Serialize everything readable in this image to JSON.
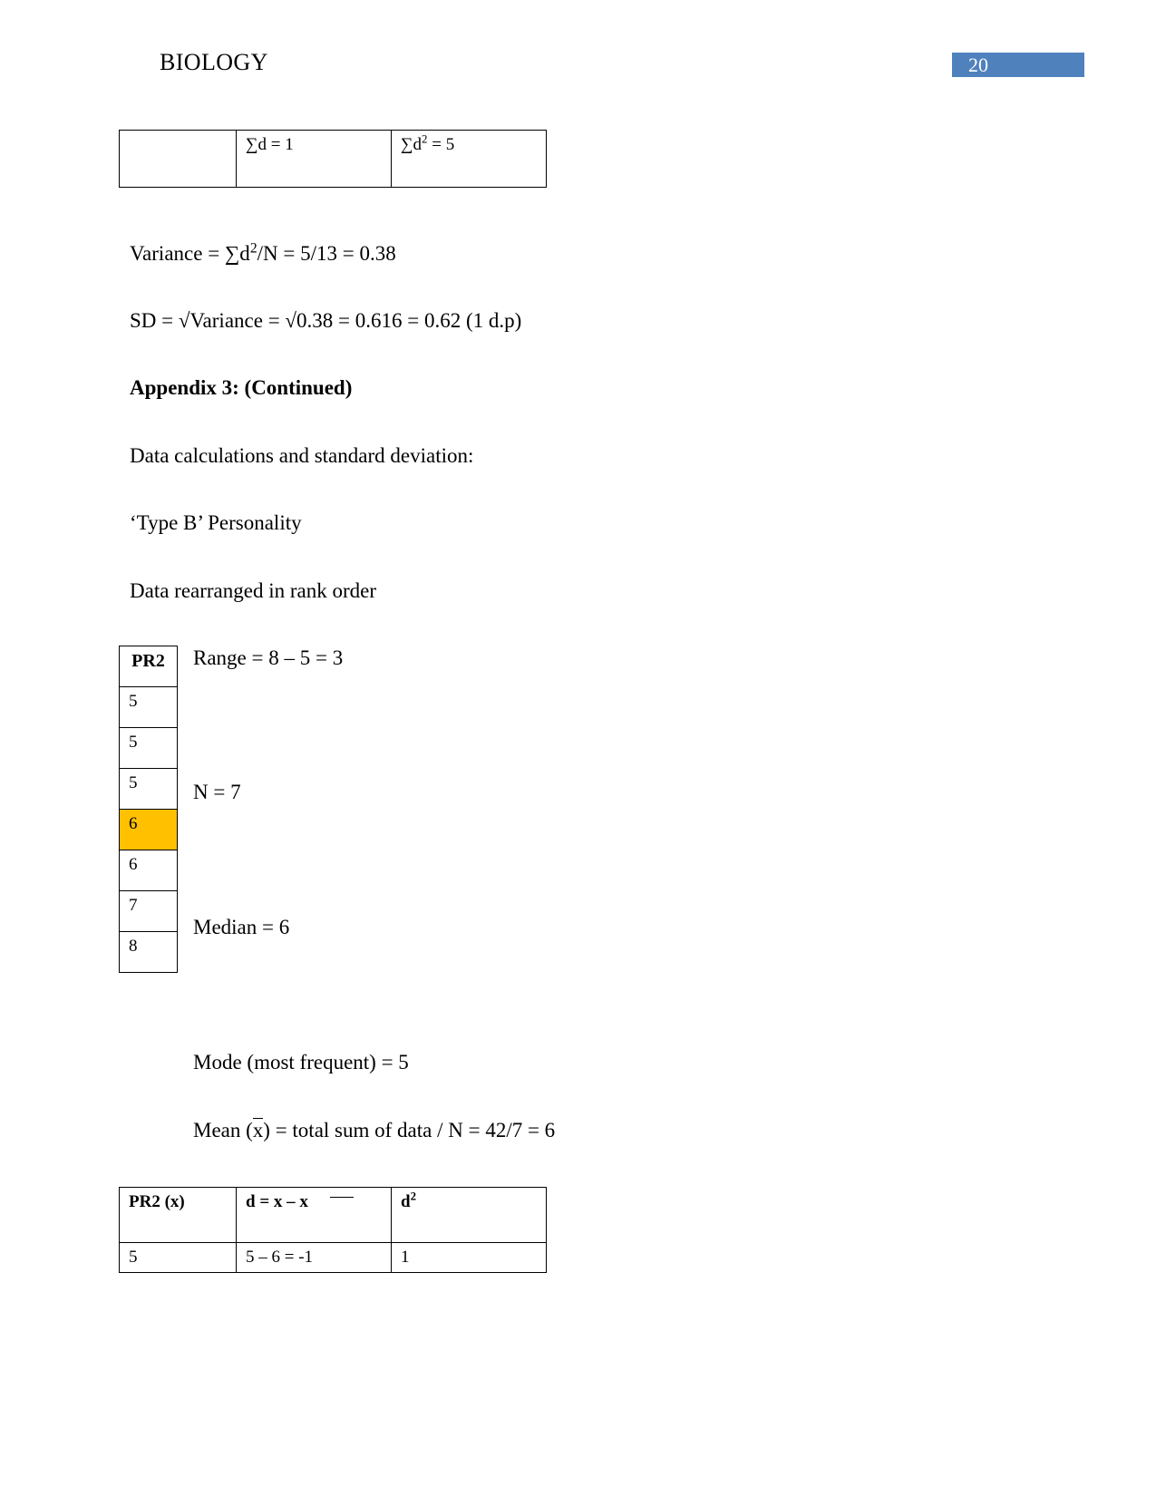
{
  "header": {
    "title": "BIOLOGY",
    "page_number": "20",
    "badge_color": "#4f81bd"
  },
  "sum_table": {
    "rows": [
      {
        "cells": [
          "",
          "∑d = 1",
          "∑d² = 5"
        ]
      }
    ]
  },
  "paragraphs": {
    "variance": "Variance = ∑d²/N = 5/13 = 0.38",
    "sd": "SD = √Variance = √0.38 = 0.616 = 0.62 (1 d.p)",
    "appendix_heading": "Appendix 3: (Continued)",
    "data_calculations": "Data calculations and standard deviation:",
    "type_b": "‘Type B’ Personality",
    "rank_order": "Data rearranged in rank order"
  },
  "rank_table": {
    "header": "PR2",
    "values": [
      "5",
      "5",
      "5",
      "6",
      "6",
      "7",
      "8"
    ],
    "highlighted_index": 3,
    "highlight_color": "#ffc000"
  },
  "annotations": {
    "range": "Range = 8 – 5 = 3",
    "n": "N = 7",
    "median": "Median = 6",
    "mode": "Mode (most frequent) = 5",
    "mean_prefix": "Mean (",
    "mean_symbol": "x",
    "mean_suffix": ") = total sum of data / N = 42/7 = 6"
  },
  "d_table": {
    "headers": {
      "col1": "PR2 (x)",
      "col2_prefix": "d = x – x",
      "col3": "d²"
    },
    "rows": [
      {
        "x": "5",
        "d": "5 – 6 = -1",
        "d2": "1"
      }
    ]
  }
}
